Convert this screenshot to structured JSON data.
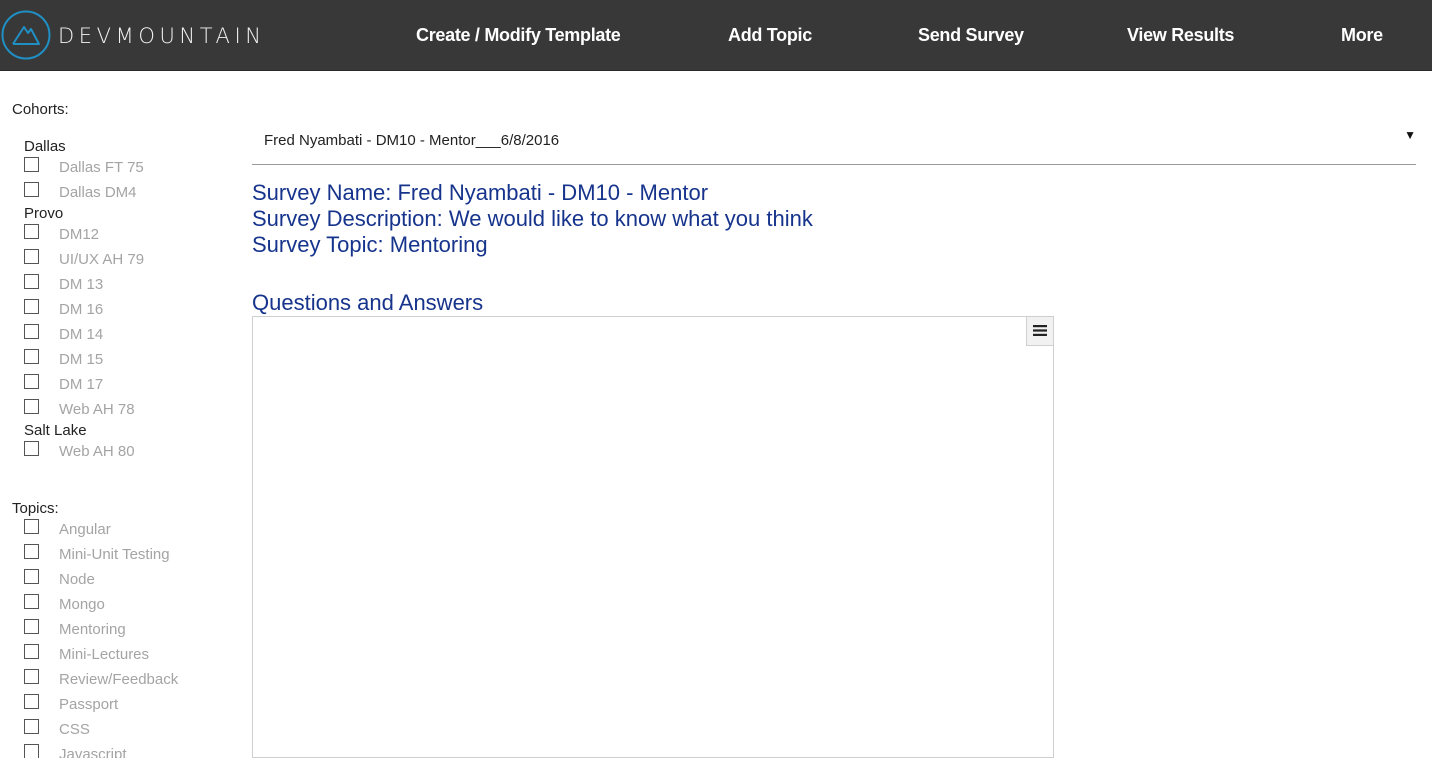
{
  "header": {
    "logo_text": "DEVMOUNTAIN",
    "nav": [
      {
        "label": "Create / Modify Template"
      },
      {
        "label": "Add Topic"
      },
      {
        "label": "Send Survey"
      },
      {
        "label": "View Results"
      },
      {
        "label": "More"
      }
    ]
  },
  "sidebar": {
    "cohorts_title": "Cohorts:",
    "cohort_groups": [
      {
        "name": "Dallas",
        "items": [
          {
            "label": "Dallas FT 75",
            "checked": false
          },
          {
            "label": "Dallas DM4",
            "checked": false
          }
        ]
      },
      {
        "name": "Provo",
        "items": [
          {
            "label": "DM12",
            "checked": false
          },
          {
            "label": "UI/UX AH 79",
            "checked": false
          },
          {
            "label": "DM 13",
            "checked": false
          },
          {
            "label": "DM 16",
            "checked": false
          },
          {
            "label": "DM 14",
            "checked": false
          },
          {
            "label": "DM 15",
            "checked": false
          },
          {
            "label": "DM 17",
            "checked": false
          },
          {
            "label": "Web AH 78",
            "checked": false
          }
        ]
      },
      {
        "name": "Salt Lake",
        "items": [
          {
            "label": "Web AH 80",
            "checked": false
          }
        ]
      }
    ],
    "topics_title": "Topics:",
    "topics": [
      {
        "label": "Angular",
        "checked": false
      },
      {
        "label": "Mini-Unit Testing",
        "checked": false
      },
      {
        "label": "Node",
        "checked": false
      },
      {
        "label": "Mongo",
        "checked": false
      },
      {
        "label": "Mentoring",
        "checked": false
      },
      {
        "label": "Mini-Lectures",
        "checked": false
      },
      {
        "label": "Review/Feedback",
        "checked": false
      },
      {
        "label": "Passport",
        "checked": false
      },
      {
        "label": "CSS",
        "checked": false
      },
      {
        "label": "Javascript",
        "checked": false
      }
    ]
  },
  "main": {
    "survey_select": {
      "value": "Fred Nyambati - DM10 - Mentor___6/8/2016",
      "arrow": "▼"
    },
    "survey_name": "Survey Name: Fred Nyambati - DM10 - Mentor",
    "survey_description": "Survey Description: We would like to know what you think",
    "survey_topic": "Survey Topic: Mentoring",
    "qa_title": "Questions and Answers"
  },
  "colors": {
    "header_bg": "#383838",
    "logo_accent": "#1f8fc4",
    "heading_blue": "#16348c",
    "muted_label": "#a4a4a4"
  }
}
